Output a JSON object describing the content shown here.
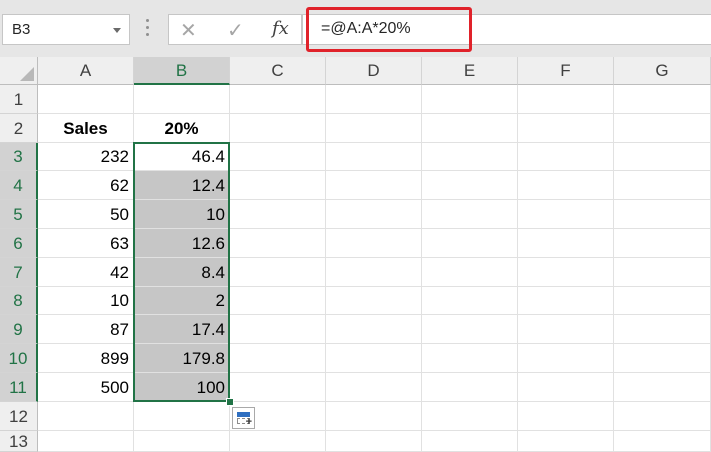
{
  "name_box": {
    "value": "B3"
  },
  "formula_bar": {
    "cancel_icon": "✕",
    "enter_icon": "✓",
    "fx_label": "fx",
    "formula": "=@A:A*20%",
    "highlight_color": "#e0222a"
  },
  "columns": [
    "A",
    "B",
    "C",
    "D",
    "E",
    "F",
    "G"
  ],
  "selected_column": "B",
  "rows": [
    {
      "n": "1",
      "a": "",
      "b": ""
    },
    {
      "n": "2",
      "a": "Sales",
      "b": "20%"
    },
    {
      "n": "3",
      "a": "232",
      "b": "46.4"
    },
    {
      "n": "4",
      "a": "62",
      "b": "12.4"
    },
    {
      "n": "5",
      "a": "50",
      "b": "10"
    },
    {
      "n": "6",
      "a": "63",
      "b": "12.6"
    },
    {
      "n": "7",
      "a": "42",
      "b": "8.4"
    },
    {
      "n": "8",
      "a": "10",
      "b": "2"
    },
    {
      "n": "9",
      "a": "87",
      "b": "17.4"
    },
    {
      "n": "10",
      "a": "899",
      "b": "179.8"
    },
    {
      "n": "11",
      "a": "500",
      "b": "100"
    },
    {
      "n": "12",
      "a": "",
      "b": ""
    },
    {
      "n": "13",
      "a": "",
      "b": ""
    }
  ],
  "selection": {
    "range": "B3:B11",
    "accent": "#217346",
    "shade": "#c6c6c6"
  }
}
